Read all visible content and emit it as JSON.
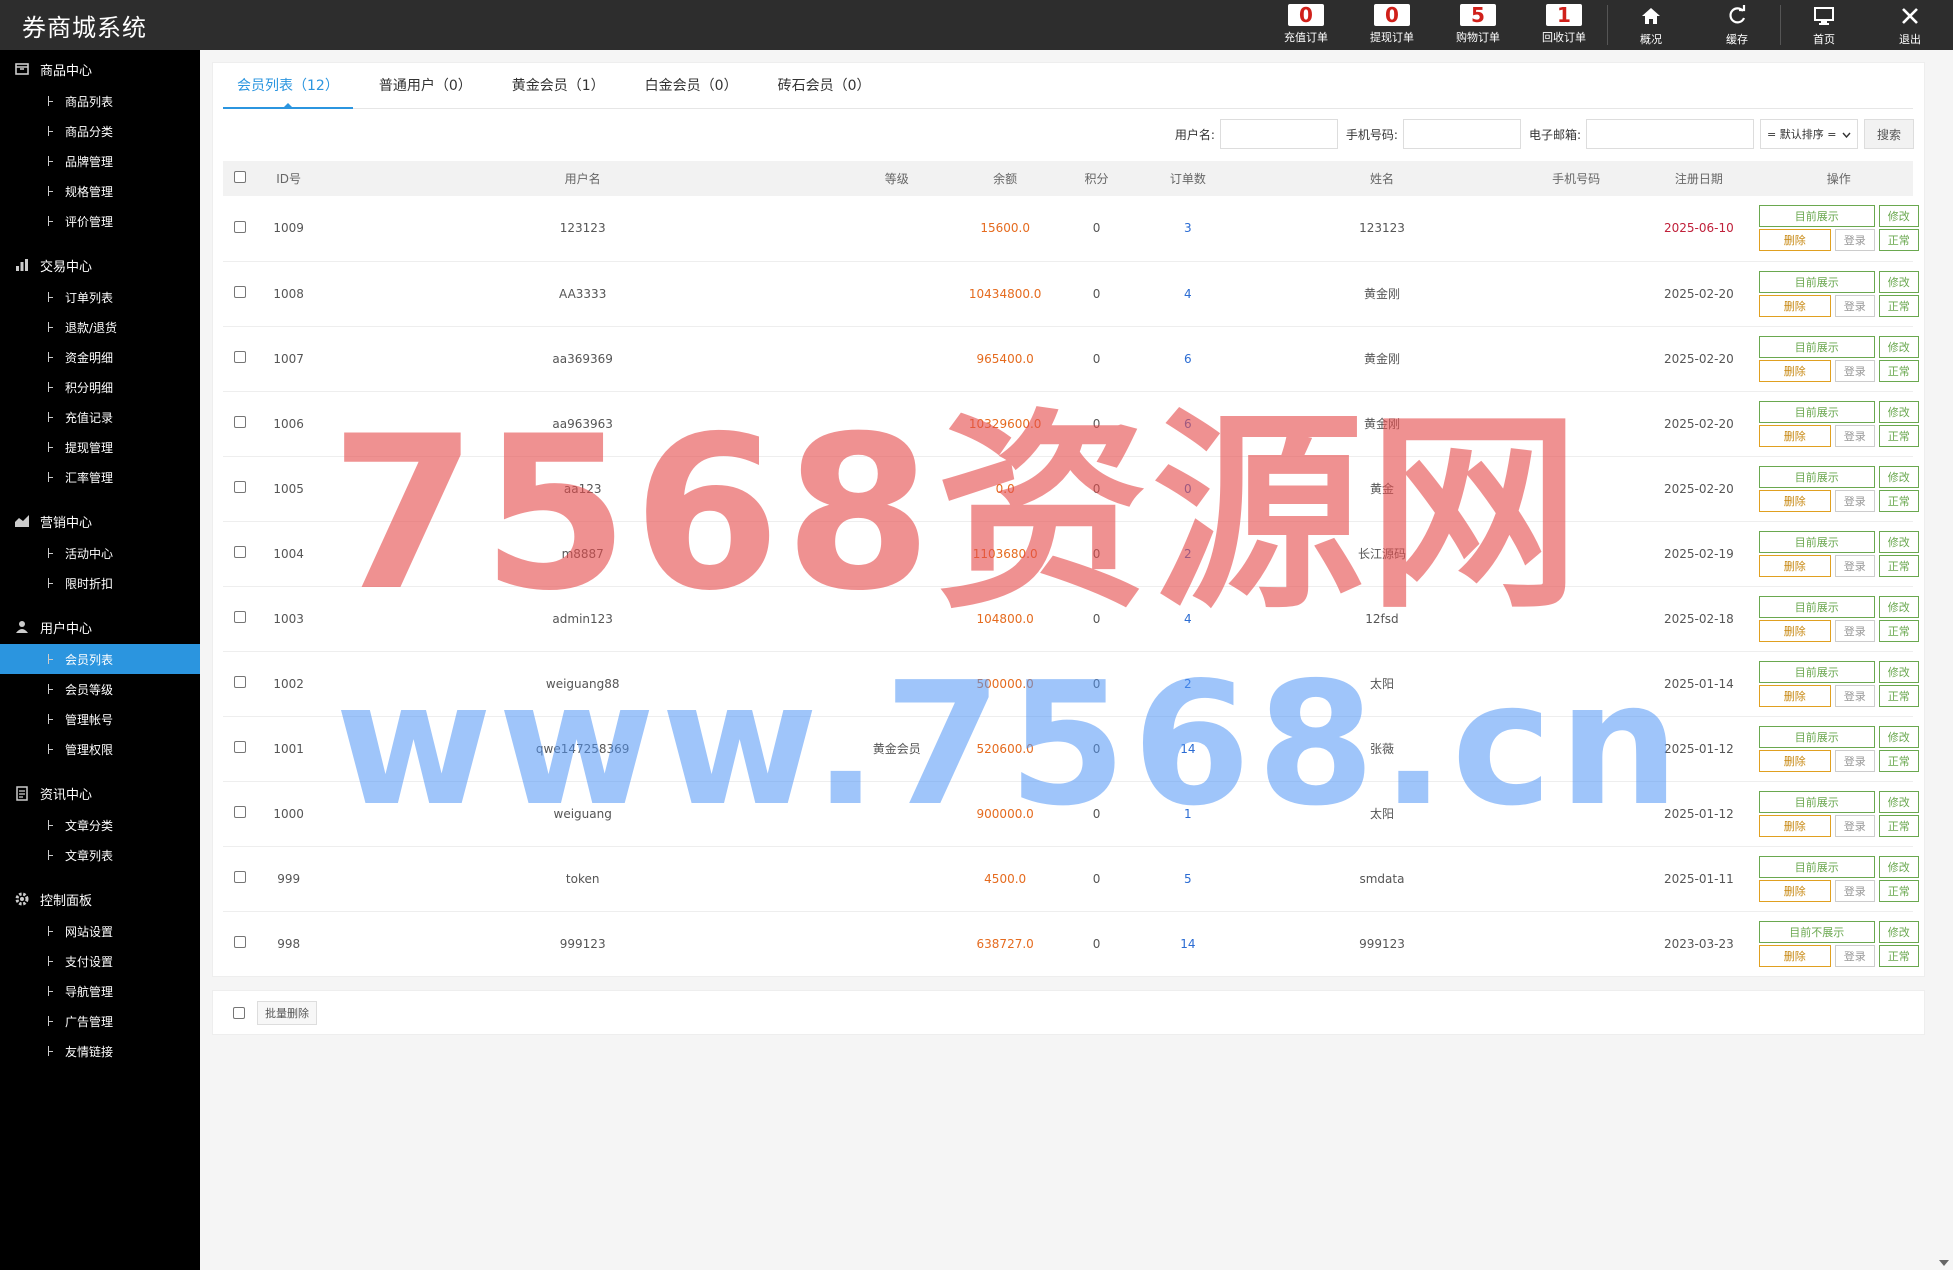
{
  "app": {
    "title": "券商城系统"
  },
  "top_actions": [
    {
      "badge": "0",
      "label": "充值订单"
    },
    {
      "badge": "0",
      "label": "提现订单"
    },
    {
      "badge": "5",
      "label": "购物订单"
    },
    {
      "badge": "1",
      "label": "回收订单"
    },
    {
      "icon": "home-icon",
      "label": "概况"
    },
    {
      "icon": "refresh-icon",
      "label": "缓存"
    },
    {
      "icon": "monitor-icon",
      "label": "首页"
    },
    {
      "icon": "close-icon",
      "label": "退出"
    }
  ],
  "sidebar": [
    {
      "title": "商品中心",
      "icon": "box-icon",
      "items": [
        "商品列表",
        "商品分类",
        "品牌管理",
        "规格管理",
        "评价管理"
      ]
    },
    {
      "title": "交易中心",
      "icon": "bar-chart-icon",
      "items": [
        "订单列表",
        "退款/退货",
        "资金明细",
        "积分明细",
        "充值记录",
        "提现管理",
        "汇率管理"
      ]
    },
    {
      "title": "营销中心",
      "icon": "area-chart-icon",
      "items": [
        "活动中心",
        "限时折扣"
      ]
    },
    {
      "title": "用户中心",
      "icon": "user-icon",
      "items": [
        "会员列表",
        "会员等级",
        "管理帐号",
        "管理权限"
      ]
    },
    {
      "title": "资讯中心",
      "icon": "document-icon",
      "items": [
        "文章分类",
        "文章列表"
      ]
    },
    {
      "title": "控制面板",
      "icon": "gear-icon",
      "items": [
        "网站设置",
        "支付设置",
        "导航管理",
        "广告管理",
        "友情链接"
      ]
    }
  ],
  "sidebar_active": "会员列表",
  "tabs": [
    "会员列表（12）",
    "普通用户（0）",
    "黄金会员（1）",
    "白金会员（0）",
    "砖石会员（0）"
  ],
  "filters": {
    "username_label": "用户名:",
    "phone_label": "手机号码:",
    "email_label": "电子邮箱:",
    "sort_selected": "= 默认排序 =",
    "search_button": "搜索"
  },
  "table": {
    "headers": [
      "ID号",
      "用户名",
      "等级",
      "余额",
      "积分",
      "订单数",
      "姓名",
      "手机号码",
      "注册日期",
      "操作"
    ],
    "rows": [
      {
        "id": "1009",
        "username": "123123",
        "level": "",
        "balance": "15600.0",
        "points": "0",
        "orders": "3",
        "name": "123123",
        "phone": "",
        "date": "2025-06-10",
        "show": "目前展示"
      },
      {
        "id": "1008",
        "username": "AA3333",
        "level": "",
        "balance": "10434800.0",
        "points": "0",
        "orders": "4",
        "name": "黄金刚",
        "phone": "",
        "date": "2025-02-20",
        "show": "目前展示"
      },
      {
        "id": "1007",
        "username": "aa369369",
        "level": "",
        "balance": "965400.0",
        "points": "0",
        "orders": "6",
        "name": "黄金刚",
        "phone": "",
        "date": "2025-02-20",
        "show": "目前展示"
      },
      {
        "id": "1006",
        "username": "aa963963",
        "level": "",
        "balance": "10329600.0",
        "points": "0",
        "orders": "6",
        "name": "黄金刚",
        "phone": "",
        "date": "2025-02-20",
        "show": "目前展示"
      },
      {
        "id": "1005",
        "username": "aa123",
        "level": "",
        "balance": "0.0",
        "points": "0",
        "orders": "0",
        "name": "黄金",
        "phone": "",
        "date": "2025-02-20",
        "show": "目前展示"
      },
      {
        "id": "1004",
        "username": "m8887",
        "level": "",
        "balance": "1103680.0",
        "points": "0",
        "orders": "2",
        "name": "长江源码",
        "phone": "",
        "date": "2025-02-19",
        "show": "目前展示"
      },
      {
        "id": "1003",
        "username": "admin123",
        "level": "",
        "balance": "104800.0",
        "points": "0",
        "orders": "4",
        "name": "12fsd",
        "phone": "",
        "date": "2025-02-18",
        "show": "目前展示"
      },
      {
        "id": "1002",
        "username": "weiguang88",
        "level": "",
        "balance": "500000.0",
        "points": "0",
        "orders": "2",
        "name": "太阳",
        "phone": "",
        "date": "2025-01-14",
        "show": "目前展示"
      },
      {
        "id": "1001",
        "username": "qwe147258369",
        "level": "黄金会员",
        "balance": "520600.0",
        "points": "0",
        "orders": "14",
        "name": "张薇",
        "phone": "",
        "date": "2025-01-12",
        "show": "目前展示"
      },
      {
        "id": "1000",
        "username": "weiguang",
        "level": "",
        "balance": "900000.0",
        "points": "0",
        "orders": "1",
        "name": "太阳",
        "phone": "",
        "date": "2025-01-12",
        "show": "目前展示"
      },
      {
        "id": "999",
        "username": "token",
        "level": "",
        "balance": "4500.0",
        "points": "0",
        "orders": "5",
        "name": "smdata",
        "phone": "",
        "date": "2025-01-11",
        "show": "目前展示"
      },
      {
        "id": "998",
        "username": "999123",
        "level": "",
        "balance": "638727.0",
        "points": "0",
        "orders": "14",
        "name": "999123",
        "phone": "",
        "date": "2023-03-23",
        "show": "目前不展示"
      }
    ],
    "op_edit": "修改",
    "op_delete": "删除",
    "op_login": "登录",
    "op_status": "正常"
  },
  "footer": {
    "bulk_delete": "批量删除"
  },
  "watermark": {
    "line1": "7568资源网",
    "line2": "www.7568.cn"
  },
  "colors": {
    "accent": "#2b95df",
    "badge": "#d0201a",
    "balance": "#e56b1f",
    "orders": "#2b6cd3"
  }
}
